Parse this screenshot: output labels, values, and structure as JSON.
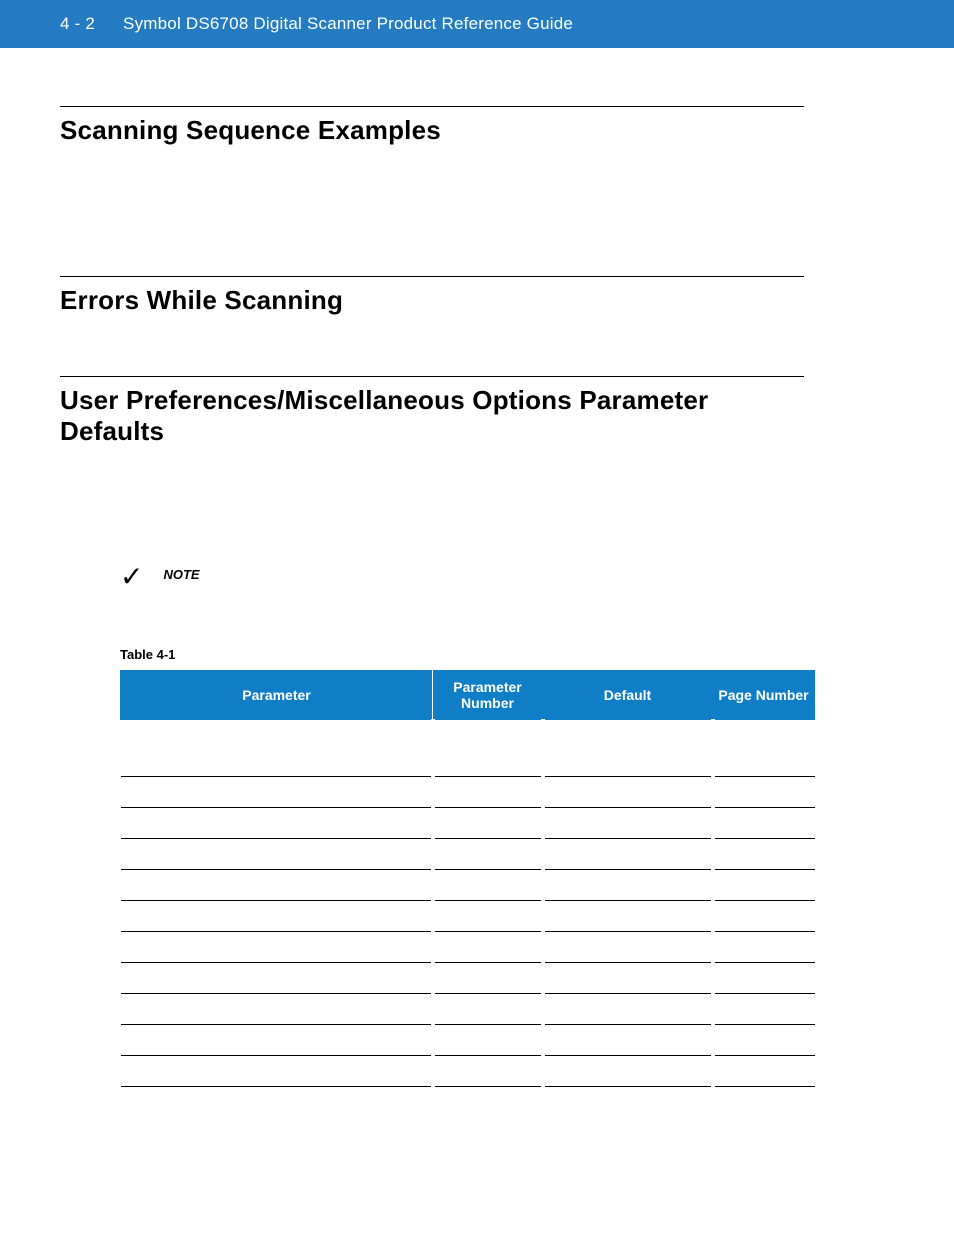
{
  "header": {
    "page_number": "4 - 2",
    "title": "Symbol DS6708 Digital Scanner Product Reference Guide"
  },
  "sections": {
    "scanning_examples": "Scanning Sequence Examples",
    "errors": "Errors While Scanning",
    "defaults": "User Preferences/Miscellaneous Options Parameter Defaults"
  },
  "note": {
    "icon_glyph": "✓",
    "label": "NOTE"
  },
  "table": {
    "caption": "Table 4-1",
    "headers": {
      "parameter": "Parameter",
      "param_number": "Parameter Number",
      "default": "Default",
      "page_number": "Page Number"
    },
    "rows": [
      {
        "type": "subhead",
        "parameter": "",
        "param_number": "",
        "default": "",
        "page_number": ""
      },
      {
        "type": "data",
        "parameter": "",
        "param_number": "",
        "default": "",
        "page_number": ""
      },
      {
        "type": "data",
        "parameter": "",
        "param_number": "",
        "default": "",
        "page_number": ""
      },
      {
        "type": "data",
        "parameter": "",
        "param_number": "",
        "default": "",
        "page_number": ""
      },
      {
        "type": "data",
        "parameter": "",
        "param_number": "",
        "default": "",
        "page_number": ""
      },
      {
        "type": "data",
        "parameter": "",
        "param_number": "",
        "default": "",
        "page_number": ""
      },
      {
        "type": "data",
        "parameter": "",
        "param_number": "",
        "default": "",
        "page_number": ""
      },
      {
        "type": "data",
        "parameter": "",
        "param_number": "",
        "default": "",
        "page_number": ""
      },
      {
        "type": "data",
        "parameter": "",
        "param_number": "",
        "default": "",
        "page_number": ""
      },
      {
        "type": "data",
        "parameter": "",
        "param_number": "",
        "default": "",
        "page_number": ""
      },
      {
        "type": "data",
        "parameter": "",
        "param_number": "",
        "default": "",
        "page_number": ""
      },
      {
        "type": "data",
        "parameter": "",
        "param_number": "",
        "default": "",
        "page_number": ""
      }
    ]
  }
}
